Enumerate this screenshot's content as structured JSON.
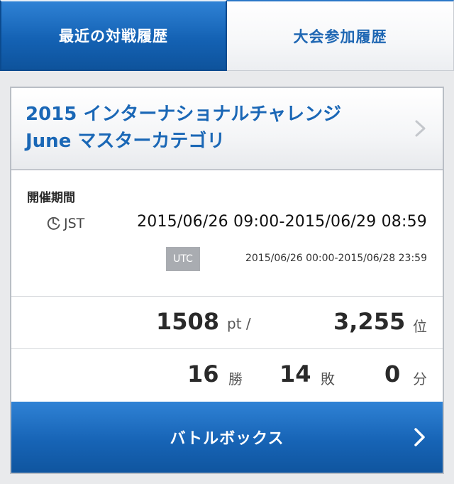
{
  "tabs": {
    "recent": "最近の対戦履歴",
    "tournament": "大会参加履歴"
  },
  "event": {
    "title_line1": "2015 インターナショナルチャレンジ",
    "title_line2": "June マスターカテゴリ"
  },
  "period": {
    "label": "開催期間",
    "jst_label": "JST",
    "jst_range": "2015/06/26 09:00-2015/06/29 08:59",
    "utc_label": "UTC",
    "utc_range": "2015/06/26 00:00-2015/06/28 23:59"
  },
  "stats": {
    "points": "1508",
    "points_unit": "pt /",
    "rank": "3,255",
    "rank_unit": "位",
    "wins": "16",
    "wins_unit": "勝",
    "losses": "14",
    "losses_unit": "敗",
    "draws": "0",
    "draws_unit": "分"
  },
  "battle_box": {
    "label": "バトルボックス"
  },
  "colors": {
    "accent_blue": "#1a67b6",
    "button_blue": "#1764b6"
  },
  "icons": {
    "clock": "clock-icon",
    "chevron": "chevron-right-icon"
  }
}
